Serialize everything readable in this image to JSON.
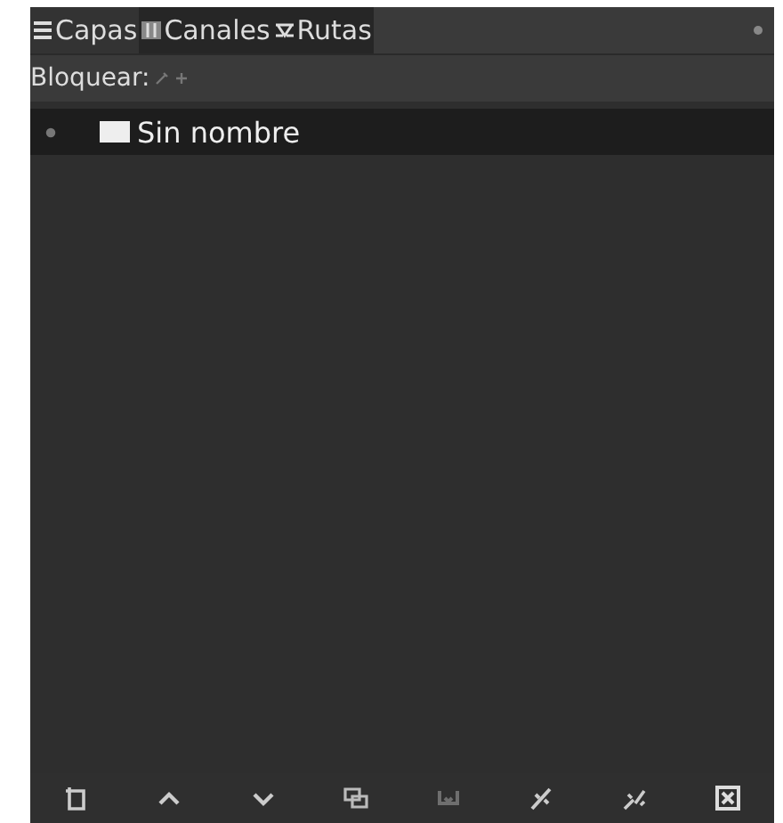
{
  "tabs": [
    {
      "label": "Capas",
      "selected": true
    },
    {
      "label": "Canales",
      "selected": false
    },
    {
      "label": "Rutas",
      "selected": false
    }
  ],
  "lock": {
    "label": "Bloquear:"
  },
  "items": [
    {
      "name": "Sin nombre",
      "visible": true,
      "selected": true
    }
  ],
  "toolbar": [
    {
      "disabled": false
    },
    {
      "disabled": false
    },
    {
      "disabled": false
    },
    {
      "disabled": false
    },
    {
      "disabled": true
    },
    {
      "disabled": false
    },
    {
      "disabled": false
    },
    {
      "disabled": false
    }
  ]
}
